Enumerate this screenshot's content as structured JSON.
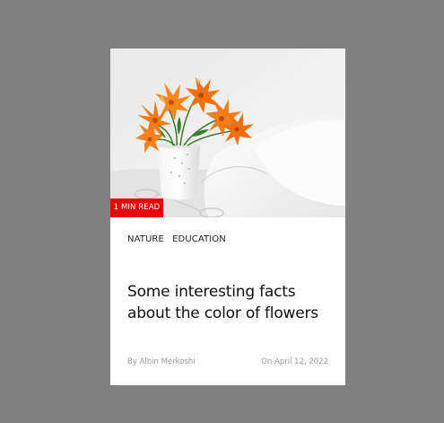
{
  "card": {
    "badge": "1 MIN READ",
    "tags": [
      "NATURE",
      "EDUCATION"
    ],
    "title": "Some interesting facts about the color of flowers",
    "author": "By Albin Merkoshi",
    "date": "On April 12, 2022",
    "image_subject": "orange-lilies-in-vase-photo"
  },
  "colors": {
    "page_background": "#808080",
    "card_background": "#ffffff",
    "badge_background": "#e8000b"
  }
}
